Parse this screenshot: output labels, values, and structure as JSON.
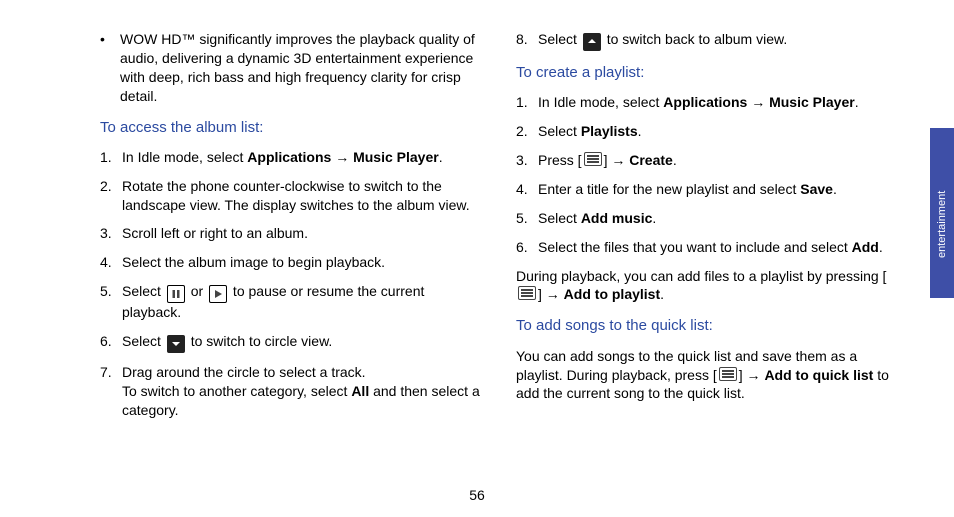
{
  "left": {
    "wow": "WOW HD™ significantly improves the playback quality of audio, delivering a dynamic 3D entertainment experience with deep, rich bass and high frequency clarity for crisp detail.",
    "title_album": "To access the album list:",
    "s1a": "In Idle mode, select ",
    "s1b": "Applications",
    "s1arrow": " → ",
    "s1c": "Music Player",
    "s1d": ".",
    "s2": "Rotate the phone counter-clockwise to switch to the landscape view. The display switches to the album view.",
    "s3": "Scroll left or right to an album.",
    "s4": "Select the album image to begin playback.",
    "s5a": "Select ",
    "s5b": " or ",
    "s5c": " to pause or resume the current playback.",
    "s6a": "Select ",
    "s6b": " to switch to circle view.",
    "s7a": "Drag around the circle to select a track.",
    "s7b": "To switch to another category, select ",
    "s7c": "All",
    "s7d": " and then select a category."
  },
  "right": {
    "s8a": "Select ",
    "s8b": " to switch back to album view.",
    "title_playlist": "To create a playlist:",
    "p1a": "In Idle mode, select ",
    "p1b": "Applications",
    "p1arrow": " → ",
    "p1c": "Music Player",
    "p1d": ".",
    "p2a": "Select ",
    "p2b": "Playlists",
    "p2c": ".",
    "p3a": "Press [",
    "p3b": "] → ",
    "p3c": "Create",
    "p3d": ".",
    "p4a": "Enter a title for the new playlist and select ",
    "p4b": "Save",
    "p4c": ".",
    "p5a": "Select ",
    "p5b": "Add music",
    "p5c": ".",
    "p6a": "Select the files that you want to include and select ",
    "p6b": "Add",
    "p6c": ".",
    "during_a": "During playback, you can add files to a playlist by pressing [",
    "during_b": "] → ",
    "during_c": "Add to playlist",
    "during_d": ".",
    "title_quick": "To add songs to the quick list:",
    "quick_a": "You can add songs to the quick list and save them as a playlist. During playback, press [",
    "quick_b": "] → ",
    "quick_c": "Add to quick list",
    "quick_d": " to add the current song to the quick list."
  },
  "side_label": "entertainment",
  "page_number": "56"
}
